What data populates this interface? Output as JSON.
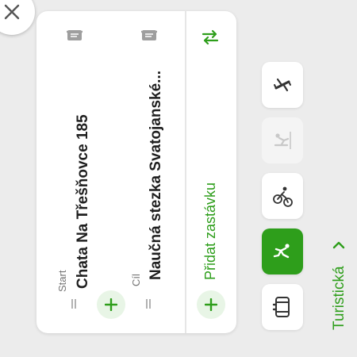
{
  "route": {
    "start_label": "Start",
    "start_value": "Chata Na Třešňovce 185",
    "end_label": "Cíl",
    "end_value": "Naučná stezka Svatojanské...",
    "add_stop": "Přidat zastávku"
  },
  "modes": [
    {
      "name": "flight",
      "icon": "plane-icon",
      "state": "normal"
    },
    {
      "name": "ski",
      "icon": "skier-icon",
      "state": "disabled"
    },
    {
      "name": "bike",
      "icon": "cyclist-icon",
      "state": "normal"
    },
    {
      "name": "walk",
      "icon": "hiker-icon",
      "state": "active"
    },
    {
      "name": "car",
      "icon": "car-icon",
      "state": "normal"
    }
  ],
  "mode_selector": {
    "label": "Turistická"
  },
  "colors": {
    "accent": "#2e9e1b",
    "panel": "#ffffff",
    "background": "#ececec"
  }
}
